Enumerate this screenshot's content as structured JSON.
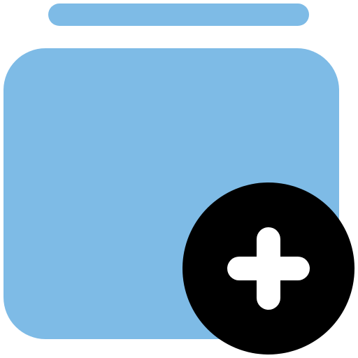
{
  "icon": {
    "name": "add-to-collection-icon",
    "parts": {
      "top_bar": "stacked-sheet",
      "main_card": "collection-card",
      "badge": "add-badge",
      "badge_symbol": "plus-icon"
    }
  },
  "colors": {
    "card": "#7EBBE6",
    "badge": "#000000",
    "plus": "#FFFFFF",
    "background": "#FFFFFF"
  }
}
